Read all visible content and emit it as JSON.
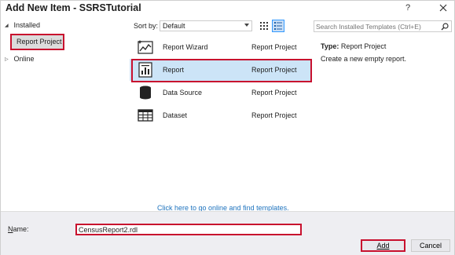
{
  "window": {
    "title": "Add New Item - SSRSTutorial",
    "help_label": "?",
    "close_icon": "close-icon"
  },
  "tree": {
    "installed_label": "Installed",
    "selected_label": "Report Project",
    "online_label": "Online"
  },
  "toolbar": {
    "sort_label": "Sort by:",
    "sort_value": "Default",
    "view_icons": [
      "grid-view-icon",
      "list-view-icon"
    ]
  },
  "templates": [
    {
      "name": "Report Wizard",
      "category": "Report Project",
      "icon": "report-wizard-icon",
      "selected": false
    },
    {
      "name": "Report",
      "category": "Report Project",
      "icon": "report-icon",
      "selected": true
    },
    {
      "name": "Data Source",
      "category": "Report Project",
      "icon": "database-icon",
      "selected": false
    },
    {
      "name": "Dataset",
      "category": "Report Project",
      "icon": "dataset-icon",
      "selected": false
    }
  ],
  "online_link": "Click here to go online and find templates.",
  "search": {
    "placeholder": "Search Installed Templates (Ctrl+E)"
  },
  "details": {
    "type_label": "Type:",
    "type_value": "Report Project",
    "description": "Create a new empty report."
  },
  "footer": {
    "name_label": "Name:",
    "name_value": "CensusReport2.rdl",
    "add_label": "Add",
    "cancel_label": "Cancel"
  },
  "colors": {
    "annotation_red": "#c8102e",
    "selection_blue": "#cce4f7",
    "link_blue": "#1e73be",
    "footer_bg": "#eeeef2"
  }
}
